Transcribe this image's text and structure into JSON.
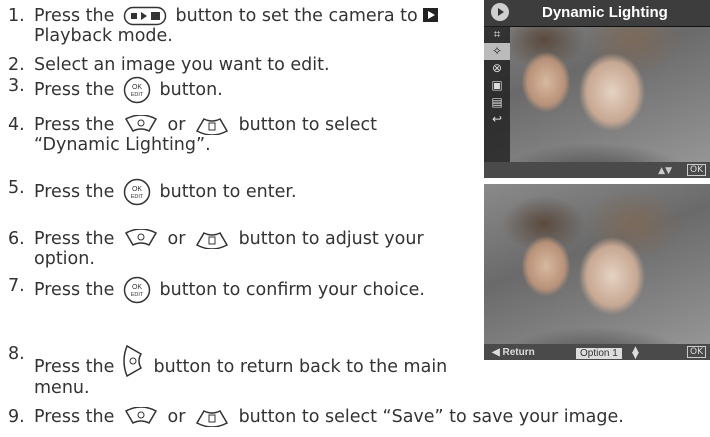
{
  "steps": [
    {
      "num": "1.",
      "parts": [
        "Press the",
        "button to set the camera to",
        "Playback mode."
      ]
    },
    {
      "num": "2.",
      "parts": [
        "Select an image you want to edit."
      ]
    },
    {
      "num": "3.",
      "parts": [
        "Press the",
        "button."
      ]
    },
    {
      "num": "4.",
      "parts": [
        "Press the",
        "or",
        "button to select “Dynamic Lighting”."
      ]
    },
    {
      "num": "5.",
      "parts": [
        "Press the",
        "button to enter."
      ]
    },
    {
      "num": "6.",
      "parts": [
        "Press the",
        "or",
        "button to adjust your option."
      ]
    },
    {
      "num": "7.",
      "parts": [
        "Press the",
        "button to confirm your choice."
      ]
    },
    {
      "num": "8.",
      "parts": [
        "Press the",
        "button to return back to the main menu."
      ]
    },
    {
      "num": "9.",
      "parts": [
        "Press the",
        "or",
        "button to select “Save” to save your image."
      ]
    }
  ],
  "ok_button_label": [
    "OK",
    "EDIT"
  ],
  "screen1": {
    "title": "Dynamic Lighting",
    "menu_icons": [
      "crop-icon",
      "dynamic-lighting-icon",
      "red-eye-icon",
      "save-icon",
      "save-as-icon",
      "return-icon"
    ],
    "footer_arrows": "▲▼",
    "footer_ok": "OK"
  },
  "screen2": {
    "return_label": "Return",
    "option_value": "Option 1",
    "footer_ok": "OK"
  }
}
